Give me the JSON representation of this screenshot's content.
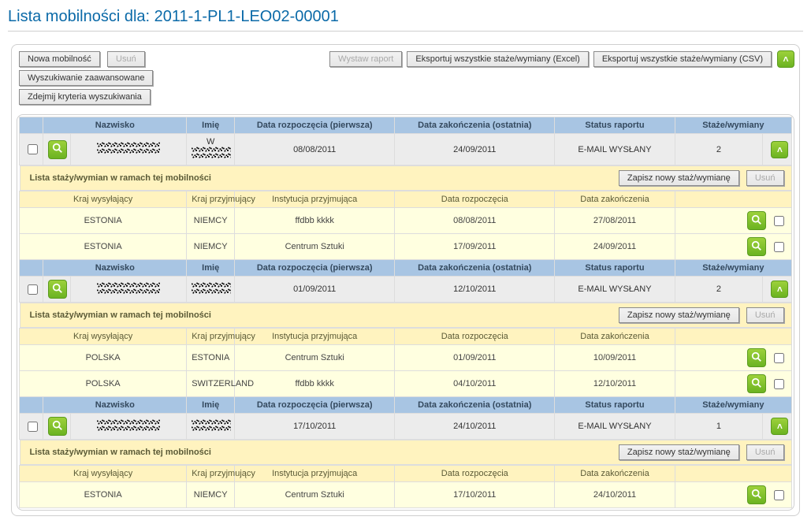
{
  "page_title": "Lista mobilności dla: 2011-1-PL1-LEO02-00001",
  "toolbar": {
    "new_mobility": "Nowa mobilność",
    "delete": "Usuń",
    "advanced_search": "Wyszukiwanie zaawansowane",
    "remove_criteria": "Zdejmij kryteria wyszukiwania",
    "issue_report": "Wystaw raport",
    "export_excel": "Eksportuj wszystkie staże/wymiany (Excel)",
    "export_csv": "Eksportuj wszystkie staże/wymiany (CSV)"
  },
  "headers": {
    "last_name": "Nazwisko",
    "first_name": "Imię",
    "start_date": "Data rozpoczęcia (pierwsza)",
    "end_date": "Data zakończenia (ostatnia)",
    "report_status": "Status raportu",
    "count": "Staże/wymiany",
    "sub_title": "Lista staży/wymian w ramach tej mobilności",
    "save_new": "Zapisz nowy staż/wymianę",
    "delete_sub": "Usuń",
    "sending_country": "Kraj wysyłający",
    "host_country": "Kraj przyjmujący",
    "host_institution": "Instytucja przyjmująca",
    "sub_start": "Data rozpoczęcia",
    "sub_end": "Data zakończenia"
  },
  "mobilities": [
    {
      "first_name_visible": "W",
      "start": "08/08/2011",
      "end": "24/09/2011",
      "status": "E-MAIL WYSŁANY",
      "count": "2",
      "placements": [
        {
          "sending": "ESTONIA",
          "host": "NIEMCY",
          "institution": "ffdbb kkkk",
          "start": "08/08/2011",
          "end": "27/08/2011"
        },
        {
          "sending": "ESTONIA",
          "host": "NIEMCY",
          "institution": "Centrum Sztuki",
          "start": "17/09/2011",
          "end": "24/09/2011"
        }
      ]
    },
    {
      "first_name_visible": "",
      "start": "01/09/2011",
      "end": "12/10/2011",
      "status": "E-MAIL WYSŁANY",
      "count": "2",
      "placements": [
        {
          "sending": "POLSKA",
          "host": "ESTONIA",
          "institution": "Centrum Sztuki",
          "start": "01/09/2011",
          "end": "10/09/2011"
        },
        {
          "sending": "POLSKA",
          "host": "SWITZERLAND",
          "institution": "ffdbb kkkk",
          "start": "04/10/2011",
          "end": "12/10/2011"
        }
      ]
    },
    {
      "first_name_visible": "",
      "start": "17/10/2011",
      "end": "24/10/2011",
      "status": "E-MAIL WYSŁANY",
      "count": "1",
      "placements": [
        {
          "sending": "ESTONIA",
          "host": "NIEMCY",
          "institution": "Centrum Sztuki",
          "start": "17/10/2011",
          "end": "24/10/2011"
        }
      ]
    }
  ]
}
